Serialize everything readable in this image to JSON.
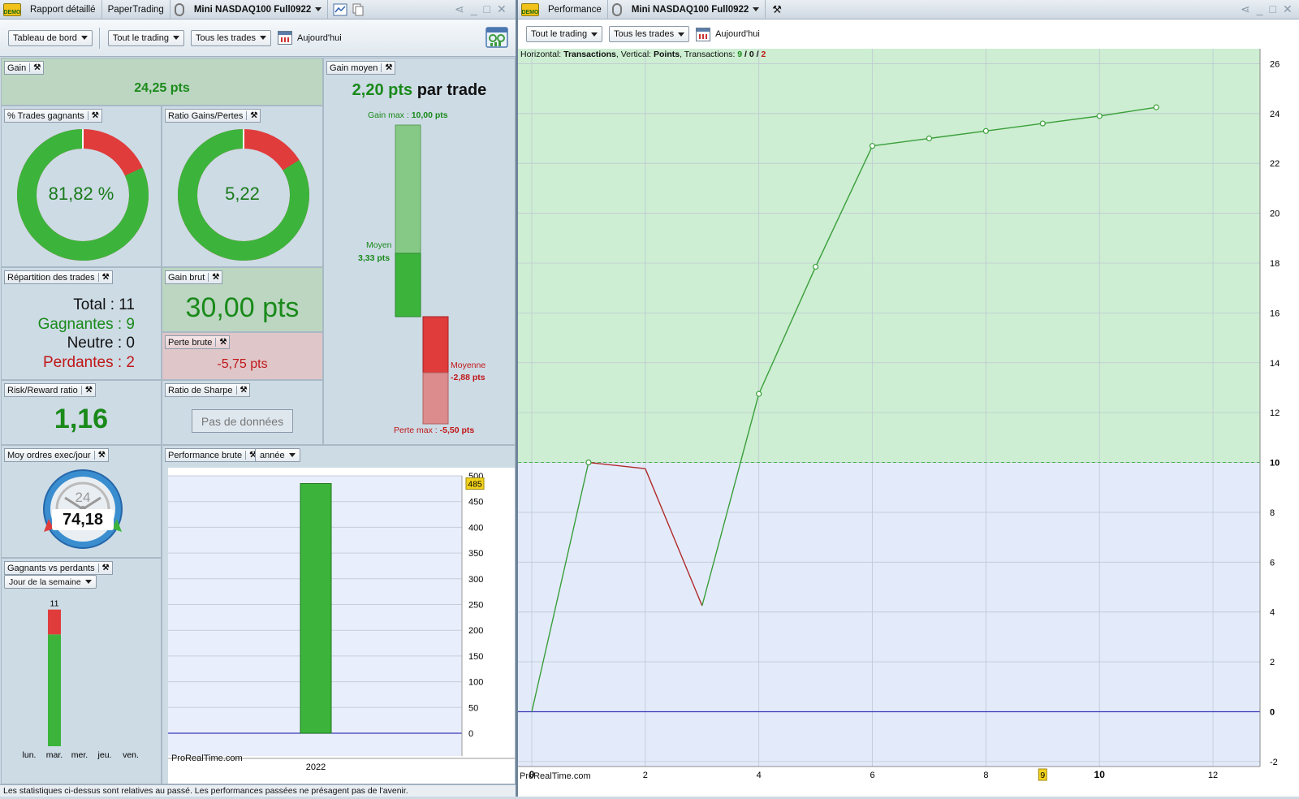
{
  "left_window": {
    "tabs": [
      "Rapport détaillé",
      "PaperTrading",
      "Mini NASDAQ100 Full0922"
    ],
    "toolbar": {
      "dashboard": "Tableau de bord",
      "all_trading": "Tout le trading",
      "all_trades": "Tous les trades",
      "today": "Aujourd'hui"
    }
  },
  "right_window": {
    "tabs": [
      "Performance",
      "Mini NASDAQ100 Full0922"
    ],
    "toolbar": {
      "all_trading": "Tout le trading",
      "all_trades": "Tous les trades",
      "today": "Aujourd'hui"
    }
  },
  "demo_badge": "DEMO",
  "gain": {
    "title": "Gain",
    "value": "24,25 pts"
  },
  "gain_moyen": {
    "title": "Gain moyen",
    "value": "2,20 pts",
    "suffix": "par trade",
    "gain_max_label": "Gain max :",
    "gain_max_value": "10,00 pts",
    "moyen_label": "Moyen",
    "moyen_value": "3,33 pts",
    "moyenne_label": "Moyenne",
    "moyenne_value": "-2,88 pts",
    "perte_max_label": "Perte max :",
    "perte_max_value": "-5,50 pts"
  },
  "pct_trades": {
    "title": "% Trades gagnants",
    "value": "81,82 %",
    "fraction": 0.8182
  },
  "ratio_gp": {
    "title": "Ratio Gains/Pertes",
    "value": "5,22",
    "fraction": 0.8392
  },
  "repartition": {
    "title": "Répartition des trades",
    "total": "Total : 11",
    "gagnantes": "Gagnantes : 9",
    "neutre": "Neutre : 0",
    "perdantes": "Perdantes : 2"
  },
  "gain_brut": {
    "title": "Gain brut",
    "value": "30,00 pts"
  },
  "perte_brute": {
    "title": "Perte brute",
    "value": "-5,75 pts"
  },
  "risk_reward": {
    "title": "Risk/Reward ratio",
    "value": "1,16"
  },
  "sharpe": {
    "title": "Ratio de Sharpe",
    "value": "Pas de données"
  },
  "moy_ordres": {
    "title": "Moy ordres exec/jour",
    "gauge_top": "24",
    "value": "74,18"
  },
  "perf_brute": {
    "title": "Performance brute",
    "period": "année",
    "watermark": "ProRealTime.com",
    "price_tag": "485"
  },
  "gvp": {
    "title": "Gagnants vs perdants",
    "mode": "Jour de la semaine",
    "count_label": "11",
    "days": [
      "lun.",
      "mar.",
      "mer.",
      "jeu.",
      "ven."
    ]
  },
  "perf_info": {
    "h_label": "Horizontal: ",
    "h_value": "Transactions",
    "v_label": ", Vertical: ",
    "v_value": "Points",
    "t_label": ", Transactions: ",
    "t_win": "9",
    "t_sep1": " / ",
    "t_neutral": "0",
    "t_sep2": " / ",
    "t_loss": "2",
    "watermark": "ProRealTime.com",
    "x_highlight": "9"
  },
  "footer": "Les statistiques ci-dessus sont relatives au passé. Les performances passées ne présagent pas de l'avenir.",
  "colors": {
    "win": "#3cb43c",
    "loss": "#e03c3c",
    "accent_green": "#1a8a1a",
    "accent_red": "#c01818"
  },
  "chart_data": [
    {
      "type": "bar",
      "categories": [
        "2022"
      ],
      "values": [
        485
      ],
      "yticks": [
        0,
        50,
        100,
        150,
        200,
        250,
        300,
        350,
        400,
        450,
        500
      ],
      "ylim": [
        0,
        500
      ]
    },
    {
      "type": "bar",
      "categories": [
        "lun.",
        "mar.",
        "mer.",
        "jeu.",
        "ven."
      ],
      "series": [
        {
          "name": "Gagnantes",
          "values": [
            0,
            9,
            0,
            0,
            0
          ]
        },
        {
          "name": "Perdantes",
          "values": [
            0,
            2,
            0,
            0,
            0
          ]
        }
      ],
      "total_label": "11"
    },
    {
      "type": "bar",
      "categories": [
        "Gain max",
        "Moyen",
        "Moyenne",
        "Perte max"
      ],
      "values": [
        10.0,
        3.33,
        -2.88,
        -5.5
      ]
    },
    {
      "type": "line",
      "x": [
        0,
        1,
        2,
        3,
        4,
        5,
        6,
        7,
        8,
        9,
        10,
        11
      ],
      "y": [
        0,
        10.0,
        9.75,
        4.25,
        12.75,
        17.85,
        22.7,
        23.0,
        23.3,
        23.6,
        23.9,
        24.25
      ],
      "segment_colors": [
        "win",
        "loss",
        "loss",
        "win",
        "win",
        "win",
        "win",
        "win",
        "win",
        "win",
        "win"
      ],
      "xlim": [
        0,
        12.8
      ],
      "ylim": [
        -2.2,
        26.6
      ],
      "xticks": [
        0,
        2,
        4,
        6,
        8,
        9,
        10,
        12
      ],
      "yticks": [
        -2,
        0,
        2,
        4,
        6,
        8,
        10,
        12,
        14,
        16,
        18,
        20,
        22,
        24,
        26
      ],
      "threshold": 10,
      "grid": true
    }
  ]
}
